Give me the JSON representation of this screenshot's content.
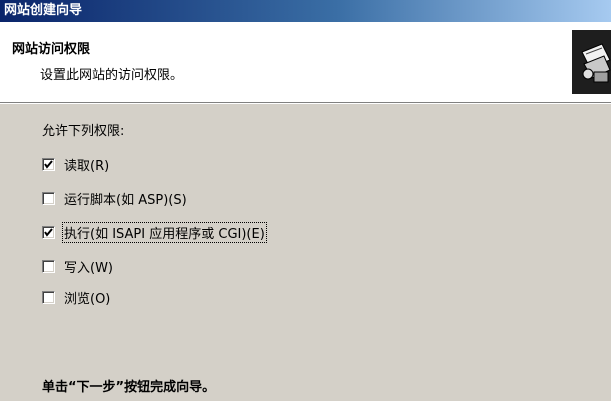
{
  "window": {
    "title": "网站创建向导"
  },
  "header": {
    "title": "网站访问权限",
    "subtitle": "设置此网站的访问权限。",
    "icon": "wizard-graphic-icon"
  },
  "permissions": {
    "group_label": "允许下列权限:",
    "items": [
      {
        "label": "读取(R)",
        "checked": true
      },
      {
        "label": "运行脚本(如 ASP)(S)",
        "checked": false
      },
      {
        "label": "执行(如 ISAPI 应用程序或 CGI)(E)",
        "checked": true
      },
      {
        "label": "写入(W)",
        "checked": false
      },
      {
        "label": "浏览(O)",
        "checked": false
      }
    ]
  },
  "footer": {
    "text": "单击“下一步”按钮完成向导。"
  },
  "colors": {
    "titlebar_start": "#0a246a",
    "titlebar_end": "#a6caf0",
    "dialog_bg": "#d4d0c8"
  }
}
